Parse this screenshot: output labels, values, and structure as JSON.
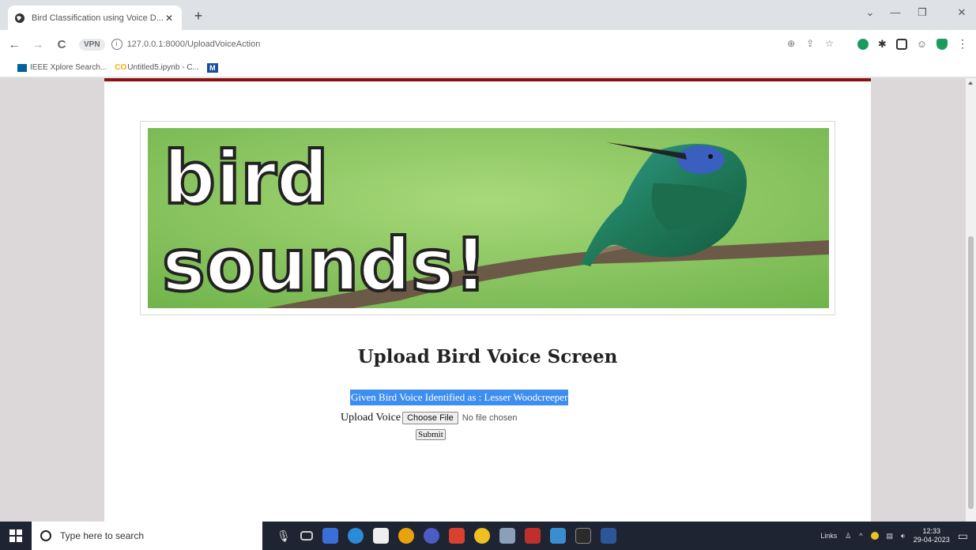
{
  "browser": {
    "tab_title": "Bird Classification using Voice D...",
    "tab_close": "✕",
    "new_tab": "+",
    "window_controls": [
      "⌄",
      "—",
      "❐",
      "✕"
    ],
    "nav": {
      "back": "←",
      "forward": "→",
      "reload": "C"
    },
    "vpn_label": "VPN",
    "url": "127.0.0.1:8000/UploadVoiceAction",
    "bookmarks": [
      {
        "label": "IEEE Xplore Search...",
        "color": "#00629b"
      },
      {
        "label": "Untitled5.ipynb - C...",
        "color": "#f9ab00"
      },
      {
        "label": "",
        "color": "#1a4fa0"
      }
    ],
    "bookmark_m": "M"
  },
  "page": {
    "banner_line1": "bird",
    "banner_line2": "sounds!",
    "heading": "Upload Bird Voice Screen",
    "result": "Given Bird Voice Identified as : Lesser Woodcreeper",
    "upload_label": "Upload Voice",
    "choose_file": "Choose File",
    "no_file": "No file chosen",
    "submit": "Submit"
  },
  "taskbar": {
    "search_placeholder": "Type here to search",
    "tray_links": "Links",
    "time": "12:33",
    "date": "29-04-2023"
  },
  "colors": {
    "accent_bar": "#8b1010",
    "result_bg": "#3d8ef0",
    "taskbar_bg": "#1f2433"
  }
}
